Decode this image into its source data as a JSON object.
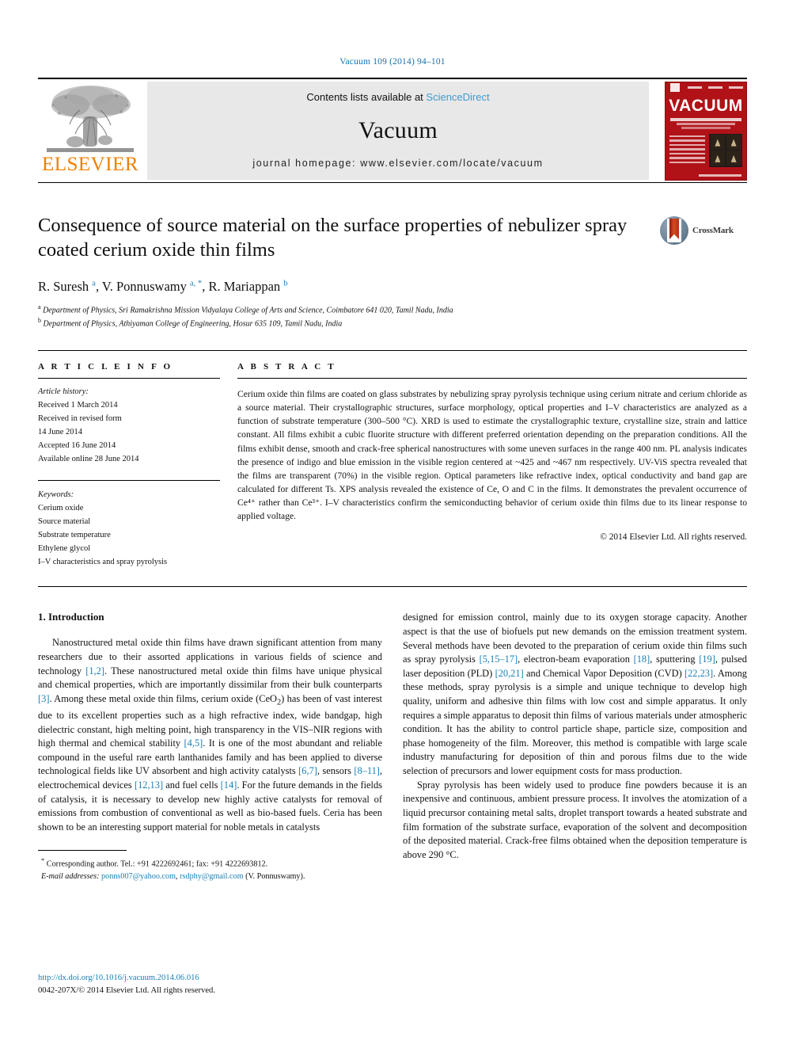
{
  "running_head": "Vacuum 109 (2014) 94–101",
  "publisher_header": {
    "logo_wordmark": "ELSEVIER",
    "logo_icon": "elsevier-tree-logo",
    "contents_line_prefix": "Contents lists available at ",
    "contents_line_link": "ScienceDirect",
    "journal_name": "Vacuum",
    "homepage_line": "journal homepage: www.elsevier.com/locate/vacuum",
    "cover_title": "VACUUM"
  },
  "article": {
    "title": "Consequence of source material on the surface properties of nebulizer spray coated cerium oxide thin films",
    "crossmark_label": "CrossMark",
    "authors_html": "R. Suresh <sup>a</sup>, V. Ponnuswamy <sup>a, *</sup>, R. Mariappan <sup>b</sup>",
    "affiliations": [
      {
        "marker": "a",
        "text": "Department of Physics, Sri Ramakrishna Mission Vidyalaya College of Arts and Science, Coimbatore 641 020, Tamil Nadu, India"
      },
      {
        "marker": "b",
        "text": "Department of Physics, Athiyaman College of Engineering, Hosur 635 109, Tamil Nadu, India"
      }
    ]
  },
  "info": {
    "heading": "A R T I C L E    I N F O",
    "history_label": "Article history:",
    "history": [
      "Received 1 March 2014",
      "Received in revised form",
      "14 June 2014",
      "Accepted 16 June 2014",
      "Available online 28 June 2014"
    ],
    "keywords_label": "Keywords:",
    "keywords": [
      "Cerium oxide",
      "Source material",
      "Substrate temperature",
      "Ethylene glycol",
      "I–V characteristics and spray pyrolysis"
    ]
  },
  "abstract": {
    "heading": "A B S T R A C T",
    "text": "Cerium oxide thin films are coated on glass substrates by nebulizing spray pyrolysis technique using cerium nitrate and cerium chloride as a source material. Their crystallographic structures, surface morphology, optical properties and I–V characteristics are analyzed as a function of substrate temperature (300–500 °C). XRD is used to estimate the crystallographic texture, crystalline size, strain and lattice constant. All films exhibit a cubic fluorite structure with different preferred orientation depending on the preparation conditions. All the films exhibit dense, smooth and crack-free spherical nanostructures with some uneven surfaces in the range 400 nm. PL analysis indicates the presence of indigo and blue emission in the visible region centered at ~425 and ~467 nm respectively. UV-ViS spectra revealed that the films are transparent (70%) in the visible region. Optical parameters like refractive index, optical conductivity and band gap are calculated for different Ts. XPS analysis revealed the existence of Ce, O and C in the films. It demonstrates the prevalent occurrence of Ce⁴⁺ rather than Ce³⁺. I–V characteristics confirm the semiconducting behavior of cerium oxide thin films due to its linear response to applied voltage.",
    "copyright": "© 2014 Elsevier Ltd. All rights reserved."
  },
  "body": {
    "section_title": "1. Introduction",
    "left_paragraph_html": "Nanostructured metal oxide thin films have drawn significant attention from many researchers due to their assorted applications in various fields of science and technology <span class=\"ref\">[1,2]</span>. These nanostructured metal oxide thin films have unique physical and chemical properties, which are importantly dissimilar from their bulk counterparts <span class=\"ref\">[3]</span>. Among these metal oxide thin films, cerium oxide (CeO<sub>2</sub>) has been of vast interest due to its excellent properties such as a high refractive index, wide bandgap, high dielectric constant, high melting point, high transparency in the VIS–NIR regions with high thermal and chemical stability <span class=\"ref\">[4,5]</span>. It is one of the most abundant and reliable compound in the useful rare earth lanthanides family and has been applied to diverse technological fields like UV absorbent and high activity catalysts <span class=\"ref\">[6,7]</span>, sensors <span class=\"ref\">[8–11]</span>, electrochemical devices <span class=\"ref\">[12,13]</span> and fuel cells <span class=\"ref\">[14]</span>. For the future demands in the fields of catalysis, it is necessary to develop new highly active catalysts for removal of emissions from combustion of conventional as well as bio-based fuels. Ceria has been shown to be an interesting support material for noble metals in catalysts",
    "right_paragraph1_html": "designed for emission control, mainly due to its oxygen storage capacity. Another aspect is that the use of biofuels put new demands on the emission treatment system. Several methods have been devoted to the preparation of cerium oxide thin films such as spray pyrolysis <span class=\"ref\">[5,15–17]</span>, electron-beam evaporation <span class=\"ref\">[18]</span>, sputtering <span class=\"ref\">[19]</span>, pulsed laser deposition (PLD) <span class=\"ref\">[20,21]</span> and Chemical Vapor Deposition (CVD) <span class=\"ref\">[22,23]</span>. Among these methods, spray pyrolysis is a simple and unique technique to develop high quality, uniform and adhesive thin films with low cost and simple apparatus. It only requires a simple apparatus to deposit thin films of various materials under atmospheric condition. It has the ability to control particle shape, particle size, composition and phase homogeneity of the film. Moreover, this method is compatible with large scale industry manufacturing for deposition of thin and porous films due to the wide selection of precursors and lower equipment costs for mass production.",
    "right_paragraph2_html": "Spray pyrolysis has been widely used to produce fine powders because it is an inexpensive and continuous, ambient pressure process. It involves the atomization of a liquid precursor containing metal salts, droplet transport towards a heated substrate and film formation of the substrate surface, evaporation of the solvent and decomposition of the deposited material. Crack-free films obtained when the deposition temperature is above 290 °C."
  },
  "footnote": {
    "corresponding_html": "<sup>*</sup> Corresponding author. Tel.: +91 4222692461; fax: +91 4222693812.",
    "emails_html": "<em>E-mail addresses:</em> <span class=\"link\">ponns007@yahoo.com</span>, <span class=\"link\">rsdphy@gmail.com</span> (V. Ponnuswamy)."
  },
  "page_footer": {
    "doi": "http://dx.doi.org/10.1016/j.vacuum.2014.06.016",
    "issn_line": "0042-207X/© 2014 Elsevier Ltd. All rights reserved."
  },
  "colors": {
    "link_blue": "#1a7fb5",
    "sciencedirect_blue": "#3d9bd4",
    "elsevier_orange": "#f08000",
    "cover_red": "#b01217"
  }
}
